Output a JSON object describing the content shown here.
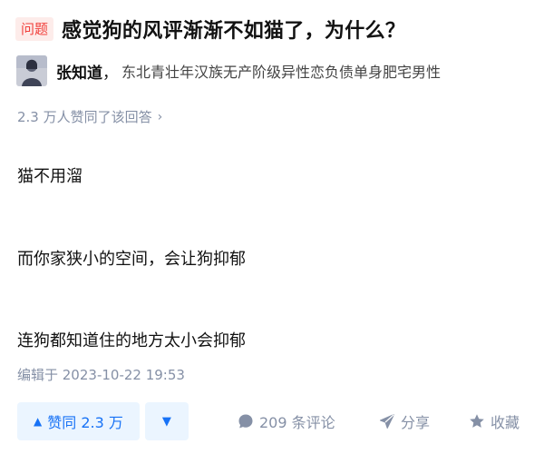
{
  "question": {
    "tag": "问题",
    "title": "感觉狗的风评渐渐不如猫了，为什么？"
  },
  "author": {
    "name": "张知道",
    "separator": "，",
    "bio": "东北青壮年汉族无产阶级异性恋负债单身肥宅男性"
  },
  "vote_summary": {
    "text": "2.3 万人赞同了该回答",
    "chevron": "›"
  },
  "answer": {
    "paragraphs": [
      "猫不用溜",
      "而你家狭小的空间，会让狗抑郁",
      "连狗都知道住的地方太小会抑郁"
    ],
    "edited": "编辑于 2023-10-22 19:53"
  },
  "actions": {
    "upvote_label": "赞同 2.3 万",
    "upvote_icon": "▲",
    "downvote_icon": "▼",
    "comment_label": "209 条评论",
    "share_label": "分享",
    "favorite_label": "收藏"
  },
  "colors": {
    "accent": "#1772f6",
    "accent_bg": "#ebf5ff",
    "muted": "#8590a6",
    "tag_text": "#f1403c",
    "tag_bg": "#fdecea"
  }
}
